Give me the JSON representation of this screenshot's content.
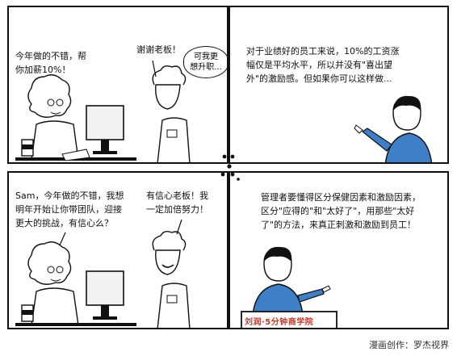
{
  "panels": [
    {
      "manager_line": "今年做的不错，帮\n你加薪10%！",
      "employee_line": "谢谢老板！",
      "thought_bubble": "可我更\n想升职..."
    },
    {
      "narration": "对于业绩好的员工来说，10%的工资涨\n幅仅是平均水平，所以并没有\"喜出望\n外\"的激励感。但如果你可以这样做..."
    },
    {
      "manager_line": "Sam，今年做的不错，我想\n明年开始让你带团队，迎接\n更大的挑战，有信心么？",
      "employee_line": "有信心老板！我\n一定加倍努力！"
    },
    {
      "narration": "管理者要懂得区分保健因素和激励因素，\n区分\"应得的\"和\"太好了\"，用那些\"太好\n了\"的方法，来真正刺激和激励到员工！",
      "desk_sign": "刘润·5分钟商学院"
    }
  ],
  "credit": "漫画创作：罗杰视界",
  "colors": {
    "ink": "#111111",
    "shirt_blue": "#3f7fc8",
    "desk_red": "#c0392b"
  },
  "icons": [
    "computer-monitor-icon",
    "coffee-cup-icon",
    "panel-divider-dots-icon"
  ]
}
